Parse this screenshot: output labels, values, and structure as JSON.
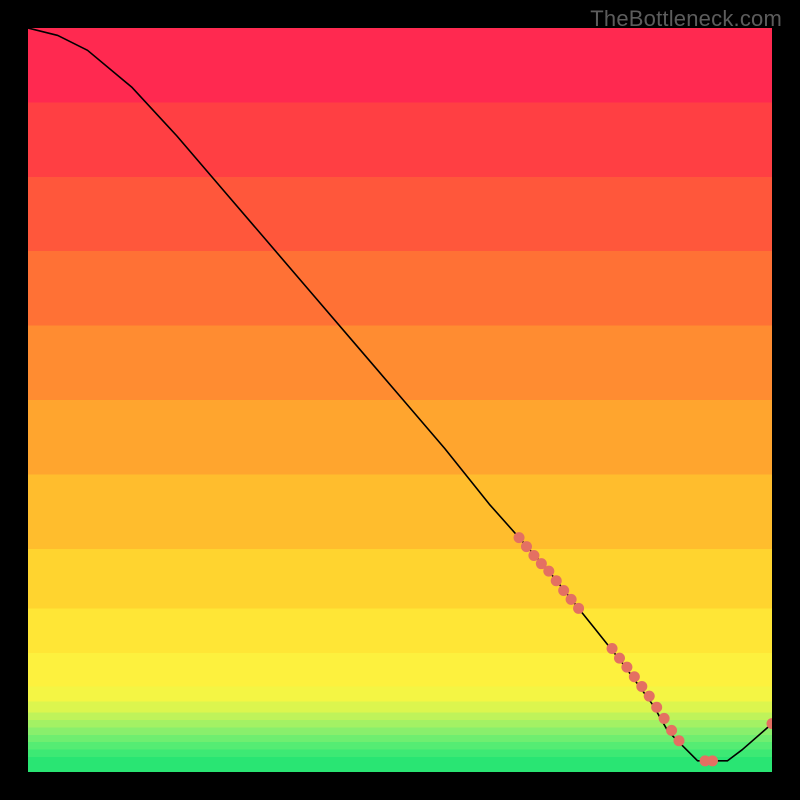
{
  "watermark": "TheBottleneck.com",
  "chart_data": {
    "type": "line",
    "title": "",
    "xlabel": "",
    "ylabel": "",
    "xlim": [
      0,
      100
    ],
    "ylim": [
      0,
      100
    ],
    "x": [
      0,
      4,
      8,
      14,
      20,
      26,
      32,
      38,
      44,
      50,
      56,
      62,
      66,
      70,
      74,
      76,
      80,
      84,
      86,
      90,
      94,
      96,
      100
    ],
    "y": [
      100,
      99,
      97,
      92,
      85.5,
      78.5,
      71.5,
      64.5,
      57.5,
      50.5,
      43.5,
      36,
      31.5,
      27,
      22,
      19.5,
      14.5,
      9,
      5.5,
      1.5,
      1.5,
      3,
      6.5
    ],
    "markers": {
      "comment": "dotted cluster near the bottom-right where many values sit near y≈0",
      "x": [
        66,
        67,
        68,
        69,
        70,
        71,
        72,
        73,
        74,
        78.5,
        79.5,
        80.5,
        81.5,
        82.5,
        83.5,
        84.5,
        85.5,
        86.5,
        87.5,
        91,
        92,
        100
      ],
      "y": [
        31.5,
        30.3,
        29.1,
        28.0,
        27.0,
        25.7,
        24.4,
        23.2,
        22.0,
        16.6,
        15.3,
        14.1,
        12.8,
        11.5,
        10.2,
        8.7,
        7.2,
        5.6,
        4.2,
        1.5,
        1.5,
        6.5
      ],
      "color": "#e47062",
      "radius": 5.5
    },
    "background_bands": [
      {
        "y0": 0.0,
        "y1": 2.0,
        "c": "#29e573"
      },
      {
        "y0": 2.0,
        "y1": 3.0,
        "c": "#3de974"
      },
      {
        "y0": 3.0,
        "y1": 4.0,
        "c": "#55ec73"
      },
      {
        "y0": 4.0,
        "y1": 5.0,
        "c": "#6fee70"
      },
      {
        "y0": 5.0,
        "y1": 6.0,
        "c": "#89ef6c"
      },
      {
        "y0": 6.0,
        "y1": 7.0,
        "c": "#a3f164"
      },
      {
        "y0": 7.0,
        "y1": 8.0,
        "c": "#bff35a"
      },
      {
        "y0": 8.0,
        "y1": 9.5,
        "c": "#dcf54e"
      },
      {
        "y0": 9.5,
        "y1": 11.5,
        "c": "#f4f544"
      },
      {
        "y0": 11.5,
        "y1": 16.0,
        "c": "#fdf13e"
      },
      {
        "y0": 16.0,
        "y1": 22.0,
        "c": "#ffe636"
      },
      {
        "y0": 22.0,
        "y1": 30.0,
        "c": "#ffd42f"
      },
      {
        "y0": 30.0,
        "y1": 40.0,
        "c": "#ffbd2d"
      },
      {
        "y0": 40.0,
        "y1": 50.0,
        "c": "#ffa52e"
      },
      {
        "y0": 50.0,
        "y1": 60.0,
        "c": "#ff8c31"
      },
      {
        "y0": 60.0,
        "y1": 70.0,
        "c": "#ff7135"
      },
      {
        "y0": 70.0,
        "y1": 80.0,
        "c": "#ff573b"
      },
      {
        "y0": 80.0,
        "y1": 90.0,
        "c": "#ff3f43"
      },
      {
        "y0": 90.0,
        "y1": 100.0,
        "c": "#ff2950"
      }
    ]
  }
}
